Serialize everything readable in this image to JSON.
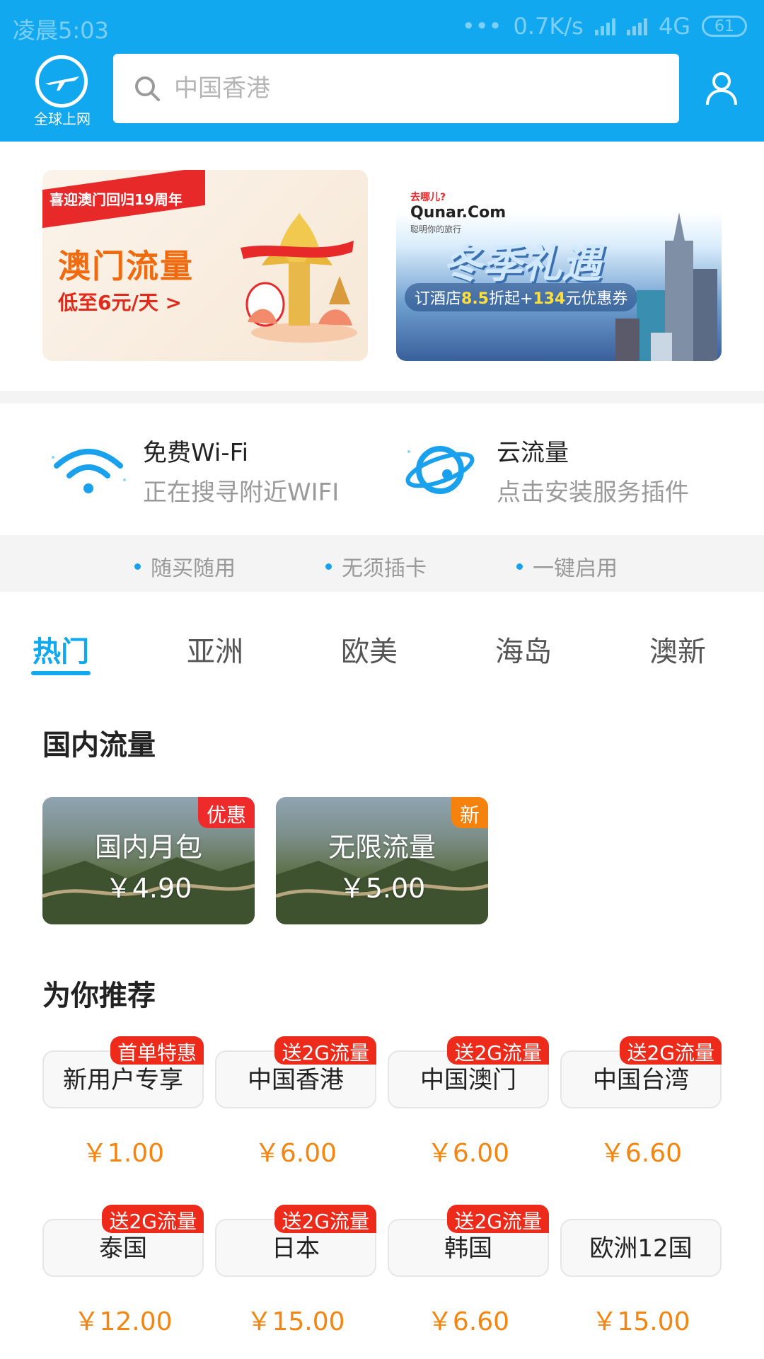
{
  "status_bar": {
    "time": "凌晨5:03",
    "network_speed": "0.7K/s",
    "network_type": "4G",
    "battery": "61"
  },
  "header": {
    "logo_text": "全球上网",
    "search_placeholder": "中国香港",
    "icons": {
      "search": "search-icon",
      "user": "user-icon",
      "logo": "plane-globe-icon"
    }
  },
  "banners": {
    "left": {
      "ribbon": "喜迎澳门回归19周年",
      "title": "澳门流量",
      "subtitle": "低至6元/天 >"
    },
    "right": {
      "brand": "Qunar.Com",
      "brand_top": "去哪儿?",
      "brand_tagline": "聪明你的旅行",
      "title": "冬季礼遇",
      "promo_prefix": "订酒店",
      "promo_discount": "8.5",
      "promo_mid": "折起+",
      "promo_amount": "134",
      "promo_suffix": "元优惠券"
    }
  },
  "features": {
    "wifi": {
      "title": "免费Wi-Fi",
      "subtitle": "正在搜寻附近WIFI",
      "icon": "wifi-icon"
    },
    "cloud": {
      "title": "云流量",
      "subtitle": "点击安装服务插件",
      "icon": "planet-icon"
    }
  },
  "perks": [
    "随买随用",
    "无须插卡",
    "一键启用"
  ],
  "tabs": [
    "热门",
    "亚洲",
    "欧美",
    "海岛",
    "澳新"
  ],
  "domestic": {
    "title": "国内流量",
    "cards": [
      {
        "name": "国内月包",
        "price": "￥4.90",
        "badge": "优惠"
      },
      {
        "name": "无限流量",
        "price": "￥5.00",
        "badge": "新"
      }
    ]
  },
  "recommend": {
    "title": "为你推荐",
    "items": [
      {
        "name": "新用户专享",
        "badge": "首单特惠",
        "price": "￥1.00"
      },
      {
        "name": "中国香港",
        "badge": "送2G流量",
        "price": "￥6.00"
      },
      {
        "name": "中国澳门",
        "badge": "送2G流量",
        "price": "￥6.00"
      },
      {
        "name": "中国台湾",
        "badge": "送2G流量",
        "price": "￥6.60"
      },
      {
        "name": "泰国",
        "badge": "送2G流量",
        "price": "￥12.00"
      },
      {
        "name": "日本",
        "badge": "送2G流量",
        "price": "￥15.00"
      },
      {
        "name": "韩国",
        "badge": "送2G流量",
        "price": "￥6.60"
      },
      {
        "name": "欧洲12国",
        "badge": "",
        "price": "￥15.00"
      }
    ]
  },
  "colors": {
    "primary": "#12a8f0",
    "price": "#f5850e",
    "badge_red": "#ee2a2a",
    "badge_orange": "#f5820d"
  }
}
